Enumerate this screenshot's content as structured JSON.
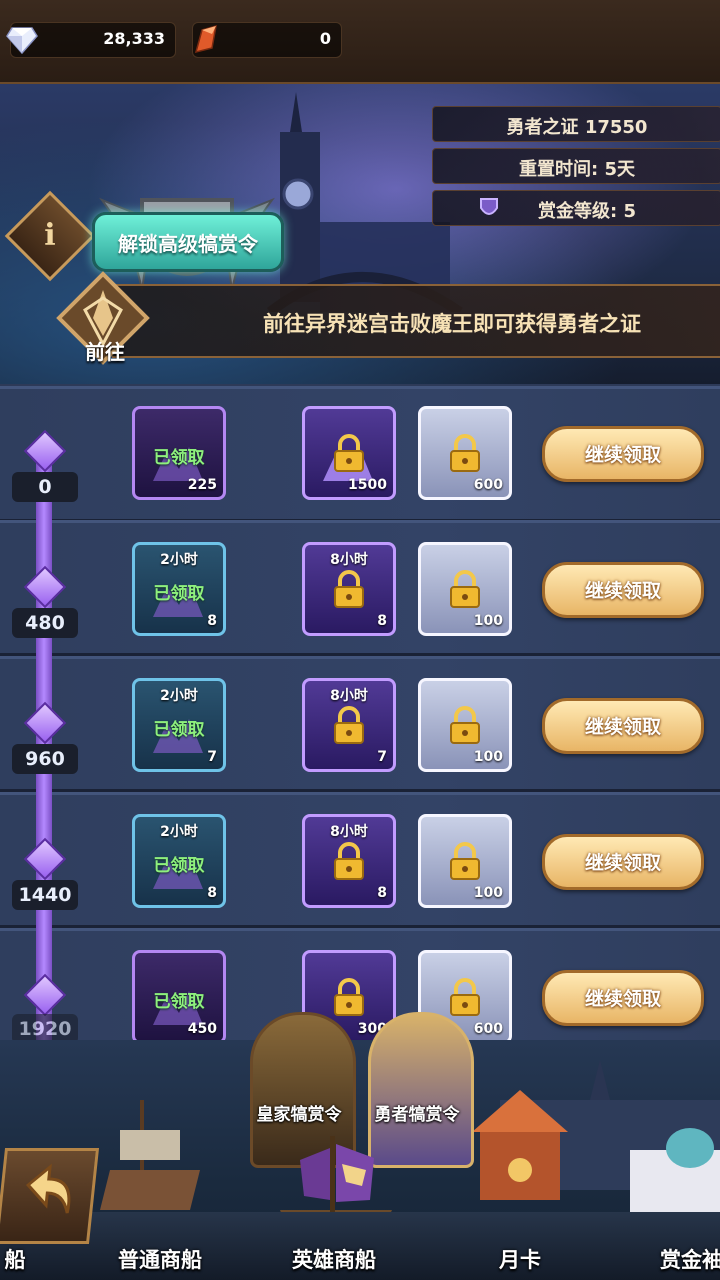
{
  "resources": {
    "gems": "28,333",
    "scrolls": "0"
  },
  "banner": {
    "unlock_button": "解锁高级犒赏令",
    "hero_proof": "勇者之证 17550",
    "reset_time": "重置时间:  5天",
    "bounty_level": "赏金等级:  5",
    "goto_text": "前往异界迷宫击败魔王即可获得勇者之证",
    "goto_label": "前往"
  },
  "rows": [
    {
      "level": "0",
      "free": {
        "qty": "225",
        "status": "已领取"
      },
      "hero": {
        "qty": "1500"
      },
      "gem": {
        "qty": "600"
      },
      "button": "继续领取"
    },
    {
      "level": "480",
      "free": {
        "top": "2小时",
        "qty": "8",
        "status": "已领取"
      },
      "hero": {
        "top": "8小时",
        "qty": "8"
      },
      "gem": {
        "qty": "100"
      },
      "button": "继续领取"
    },
    {
      "level": "960",
      "free": {
        "top": "2小时",
        "qty": "7",
        "status": "已领取"
      },
      "hero": {
        "top": "8小时",
        "qty": "7"
      },
      "gem": {
        "qty": "100"
      },
      "button": "继续领取"
    },
    {
      "level": "1440",
      "free": {
        "top": "2小时",
        "qty": "8",
        "status": "已领取"
      },
      "hero": {
        "top": "8小时",
        "qty": "8"
      },
      "gem": {
        "qty": "100"
      },
      "button": "继续领取"
    },
    {
      "level": "1920",
      "free": {
        "qty": "450",
        "status": "已领取"
      },
      "hero": {
        "qty": "300"
      },
      "gem": {
        "qty": "600"
      },
      "button": "继续领取"
    }
  ],
  "portraits": {
    "royal": "皇家犒赏令",
    "hero": "勇者犒赏令"
  },
  "nav": {
    "left_cut": "船",
    "normal_ship": "普通商船",
    "hero_ship": "英雄商船",
    "monthly_card": "月卡",
    "bounty_cut": "赏金袖"
  },
  "colors": {
    "accent_purple": "#b487f2",
    "claimed_green": "#8ef07d",
    "button_gold": "#e8b566",
    "unlock_teal": "#6ff0d8"
  }
}
